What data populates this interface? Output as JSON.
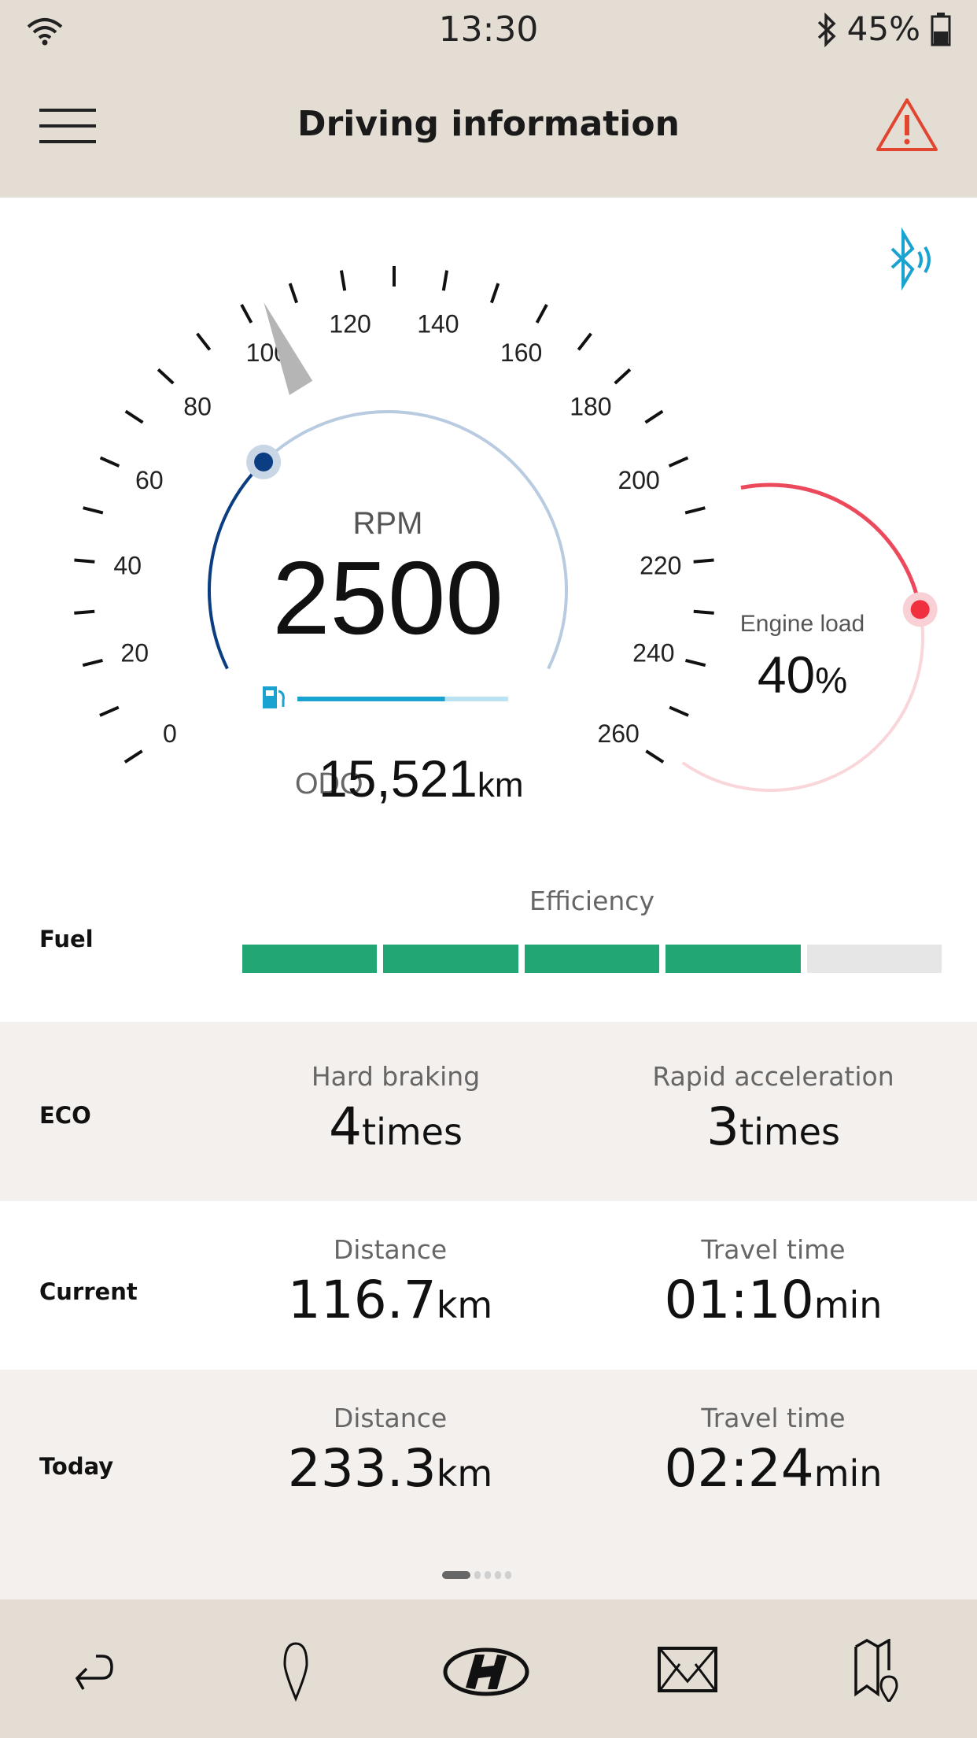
{
  "status_bar": {
    "time": "13:30",
    "battery": "45%",
    "icons": [
      "wifi-icon",
      "bluetooth-icon",
      "battery-icon"
    ]
  },
  "header": {
    "title": "Driving information",
    "menu_icon": "hamburger-icon",
    "alert_icon": "warning-icon"
  },
  "gauge": {
    "speed_labels": [
      "0",
      "20",
      "40",
      "60",
      "80",
      "100",
      "120",
      "140",
      "160",
      "180",
      "200",
      "220",
      "240",
      "260"
    ],
    "speed_min": 0,
    "speed_max": 260,
    "speed_value": 104,
    "rpm_label": "RPM",
    "rpm_value": "2500",
    "rpm_fraction": 0.31,
    "fuel_level": 0.7,
    "odo_label": "ODO",
    "odo_value": "15,521",
    "odo_unit": "km",
    "engine_load_label": "Engine load",
    "engine_load_value": "40",
    "engine_load_unit": "%",
    "engine_load_fraction": 0.4,
    "colors": {
      "rpm": "#0a3d82",
      "rpm_track": "#b9cbe0",
      "engine": "#ec4a5c",
      "engine_track": "#f9d6da",
      "fuel": "#1aa3d0",
      "bluetooth": "#1aa3d0"
    }
  },
  "fuel": {
    "label": "Fuel",
    "efficiency_label": "Efficiency",
    "segments_filled": 4,
    "segments_total": 5,
    "color": "#22a673"
  },
  "eco": {
    "label": "ECO",
    "hard_braking_label": "Hard braking",
    "hard_braking_value": "4",
    "hard_braking_unit": "times",
    "rapid_accel_label": "Rapid acceleration",
    "rapid_accel_value": "3",
    "rapid_accel_unit": "times"
  },
  "current": {
    "label": "Current",
    "distance_label": "Distance",
    "distance_value": "116.7",
    "distance_unit": "km",
    "time_label": "Travel time",
    "time_value": "01:10",
    "time_unit": "min"
  },
  "today": {
    "label": "Today",
    "distance_label": "Distance",
    "distance_value": "233.3",
    "distance_unit": "km",
    "time_label": "Travel time",
    "time_value": "02:24",
    "time_unit": "min"
  },
  "pager": {
    "pages": 5,
    "current": 1
  },
  "nav": {
    "items": [
      "back-icon",
      "location-pin-icon",
      "hyundai-logo-icon",
      "mail-icon",
      "map-icon"
    ]
  }
}
